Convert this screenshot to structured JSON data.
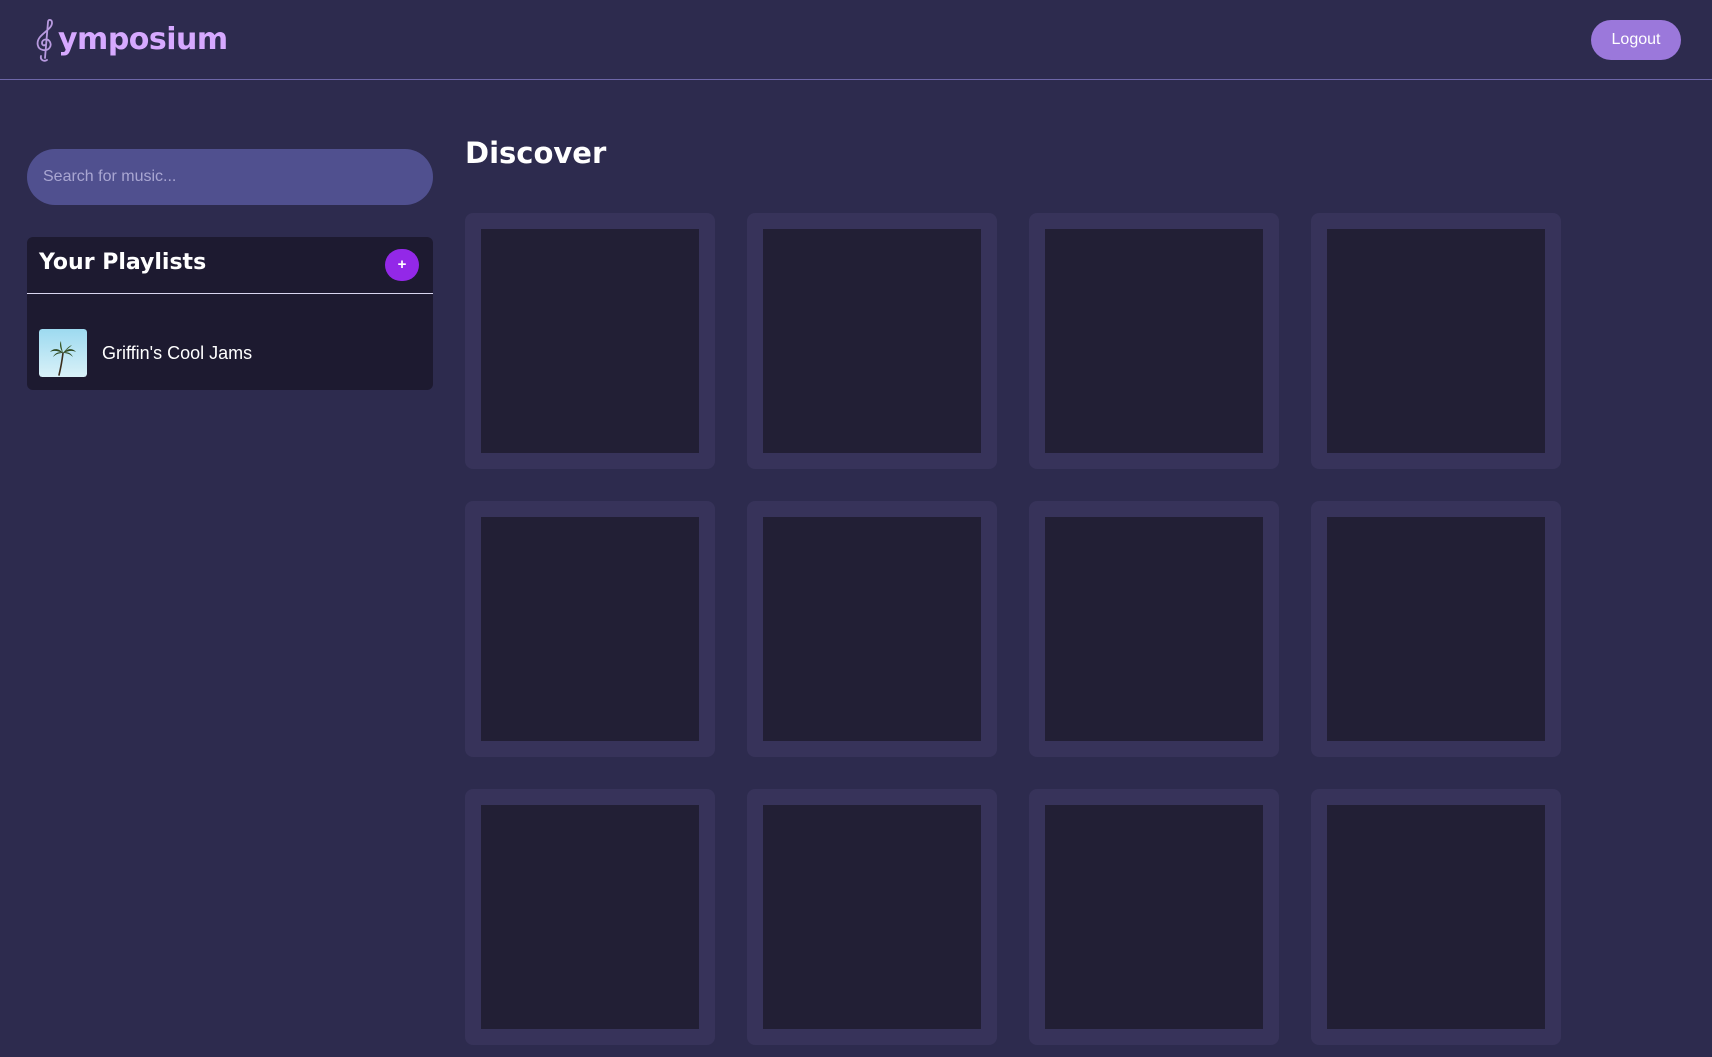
{
  "app": {
    "logo_text": "ymposium",
    "logo_icon": "treble-clef-icon",
    "logout_label": "Logout",
    "colors": {
      "background": "#2d2b4e",
      "accent": "#d6a9ff",
      "logout_button": "#9b78db",
      "add_button": "#9328e8",
      "panel": "#1d1a30",
      "card": "#37335a",
      "card_art_placeholder": "#221f35",
      "search_bg": "#50508f"
    }
  },
  "sidebar": {
    "search": {
      "placeholder": "Search for music...",
      "value": ""
    },
    "playlists": {
      "title": "Your Playlists",
      "add_label": "+",
      "items": [
        {
          "name": "Griffin's Cool Jams",
          "thumbnail_icon": "palm-tree-icon"
        }
      ]
    }
  },
  "main": {
    "title": "Discover",
    "card_count": 12
  }
}
